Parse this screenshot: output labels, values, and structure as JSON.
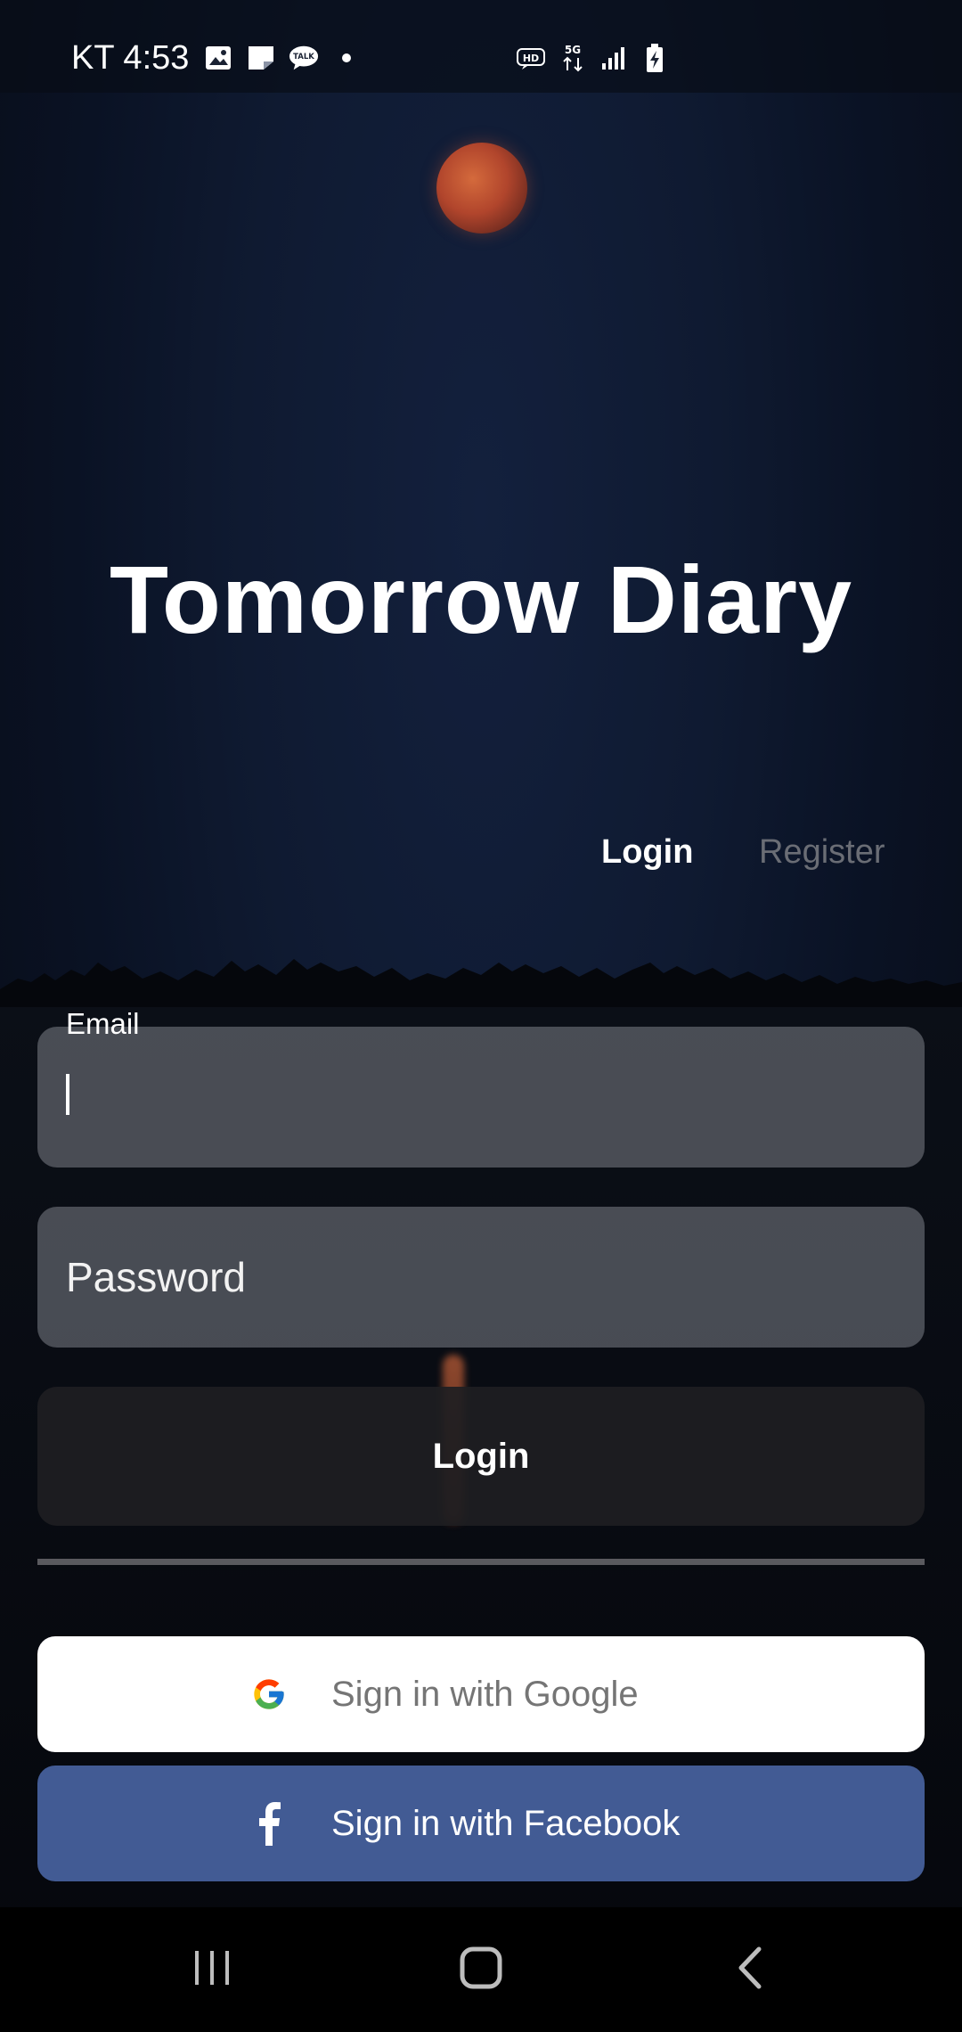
{
  "status_bar": {
    "time": "KT 4:53",
    "left_icons": [
      "gallery-icon",
      "note-icon",
      "talk-icon",
      "dot-icon"
    ],
    "talk_badge": "TALK",
    "right_icons": [
      "hd-icon",
      "5g-icon",
      "signal-icon",
      "battery-charging-icon"
    ],
    "hd_label": "HD",
    "network_label": "5G"
  },
  "app": {
    "title": "Tomorrow Diary"
  },
  "tabs": {
    "login_label": "Login",
    "register_label": "Register",
    "active": "Login"
  },
  "form": {
    "email_label": "Email",
    "email_value": "",
    "password_placeholder": "Password",
    "password_value": "",
    "login_button_label": "Login"
  },
  "social": {
    "google_label": "Sign in with Google",
    "facebook_label": "Sign in with Facebook"
  },
  "colors": {
    "facebook_blue": "#425b94",
    "google_button_bg": "#ffffff",
    "inactive_tab": "#6a6d75",
    "moon": "#b1452c"
  },
  "nav_bar": {
    "buttons": [
      "recents-icon",
      "home-icon",
      "back-icon"
    ]
  }
}
